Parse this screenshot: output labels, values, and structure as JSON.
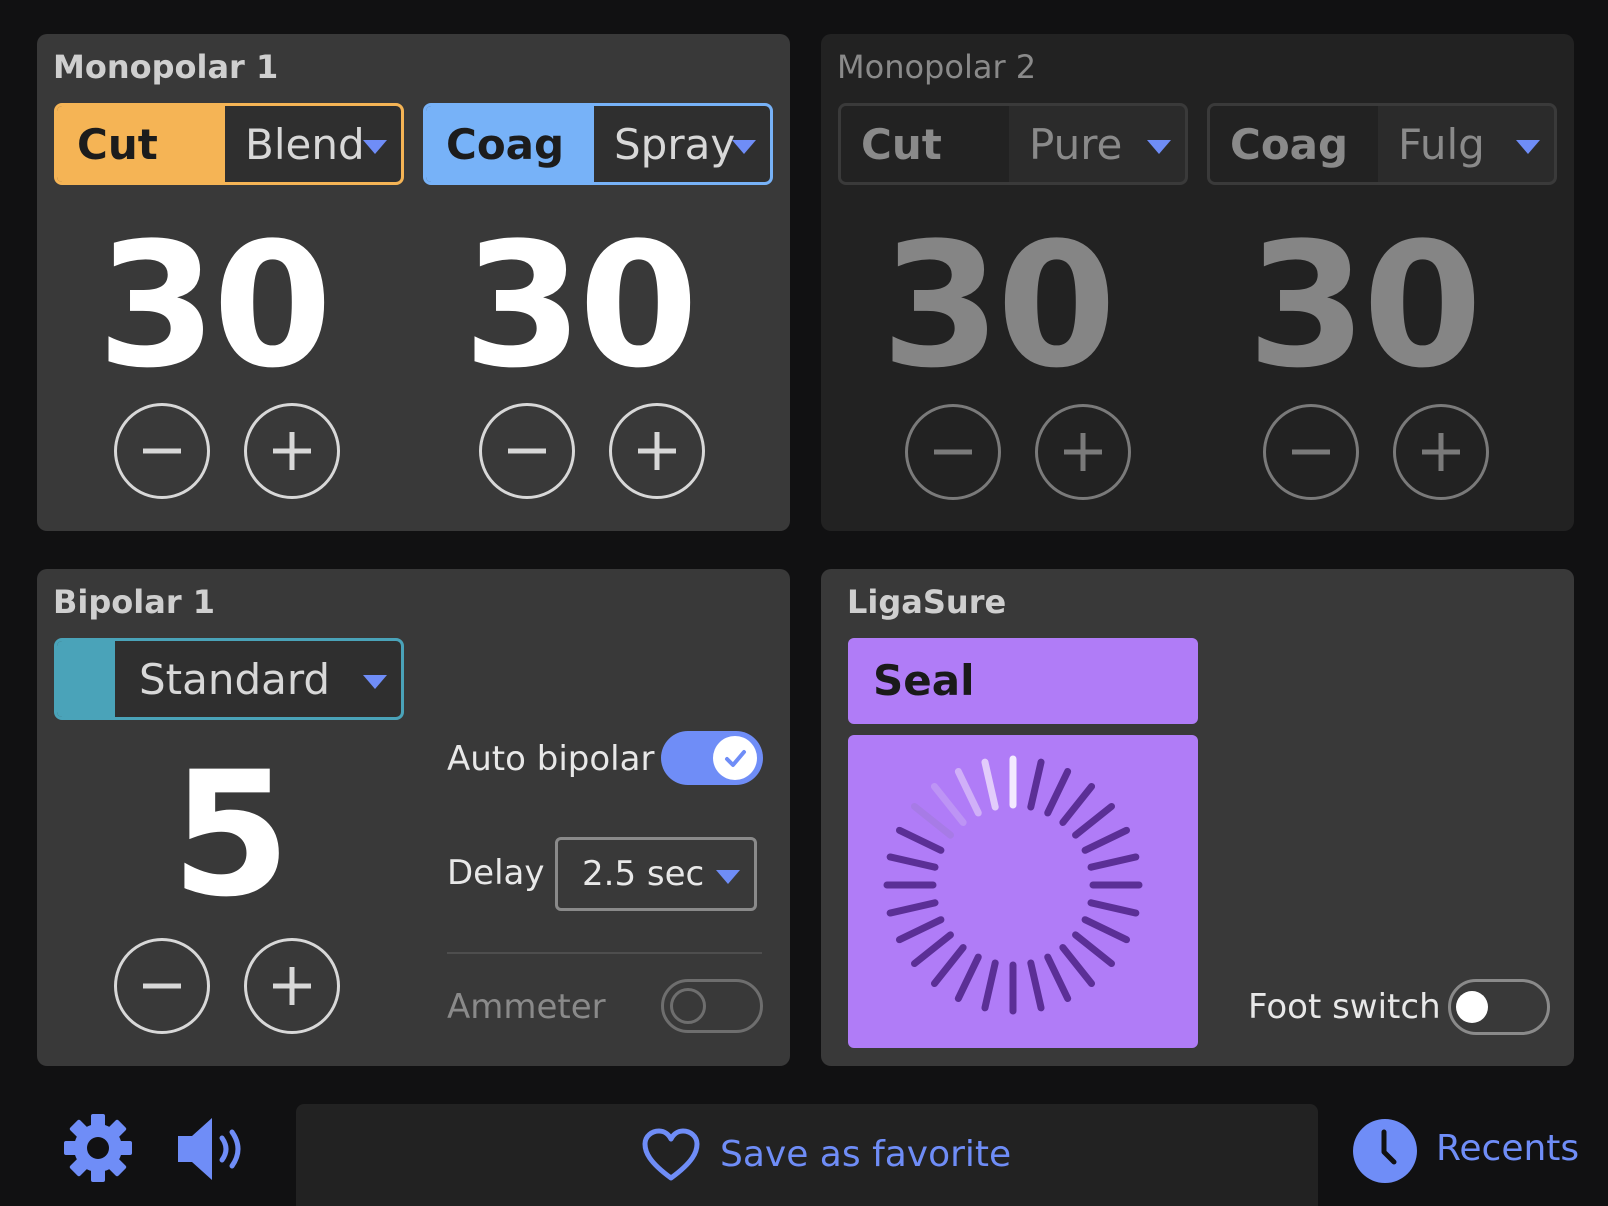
{
  "monopolar1": {
    "title": "Monopolar 1",
    "cut": {
      "label": "Cut",
      "mode": "Blend",
      "value": "30",
      "color": "#f5b455"
    },
    "coag": {
      "label": "Coag",
      "mode": "Spray",
      "value": "30",
      "color": "#77b2f8"
    }
  },
  "monopolar2": {
    "title": "Monopolar 2",
    "cut": {
      "label": "Cut",
      "mode": "Pure",
      "value": "30"
    },
    "coag": {
      "label": "Coag",
      "mode": "Fulg",
      "value": "30"
    }
  },
  "bipolar1": {
    "title": "Bipolar 1",
    "mode": "Standard",
    "value": "5",
    "color": "#4aa3b9",
    "auto_bipolar_label": "Auto bipolar",
    "auto_bipolar_on": true,
    "delay_label": "Delay",
    "delay_value": "2.5 sec",
    "ammeter_label": "Ammeter",
    "ammeter_on": false
  },
  "ligasure": {
    "title": "LigaSure",
    "mode": "Seal",
    "color": "#b07cf7",
    "foot_switch_label": "Foot switch",
    "foot_switch_on": false
  },
  "footer": {
    "save_label": "Save as favorite",
    "recents_label": "Recents",
    "accent": "#6f8df7"
  },
  "icons": [
    "gear-icon",
    "speaker-icon",
    "heart-icon",
    "clock-icon",
    "minus-icon",
    "plus-icon",
    "check-icon",
    "spinner-icon"
  ]
}
